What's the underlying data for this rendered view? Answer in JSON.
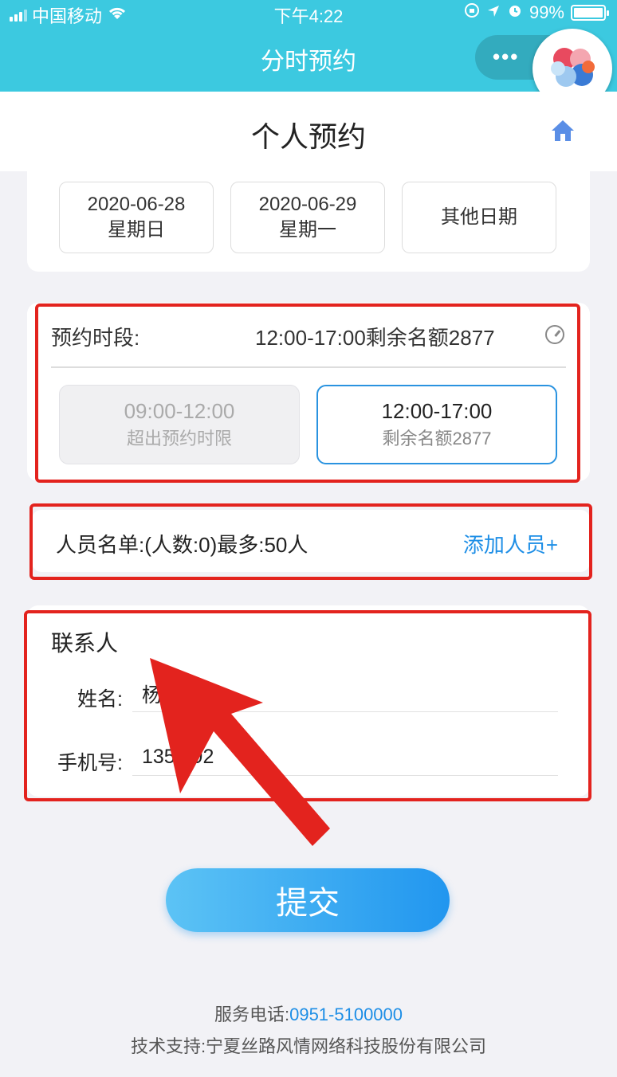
{
  "status_bar": {
    "carrier": "中国移动",
    "time": "下午4:22",
    "battery": "99%",
    "battery_level": 0.99
  },
  "nav": {
    "title": "分时预约",
    "more_icon": "more-dots-icon",
    "float_icon": "colorful-logo-icon"
  },
  "page": {
    "title": "个人预约",
    "home_icon": "home-icon"
  },
  "dates": [
    {
      "date": "2020-06-28",
      "weekday": "星期日"
    },
    {
      "date": "2020-06-29",
      "weekday": "星期一"
    },
    {
      "label": "其他日期"
    }
  ],
  "time_period": {
    "label": "预约时段:",
    "selected": "12:00-17:00剩余名额2877",
    "icon": "gauge-icon",
    "slots": [
      {
        "time": "09:00-12:00",
        "status": "超出预约时限",
        "disabled": true
      },
      {
        "time": "12:00-17:00",
        "status": "剩余名额2877",
        "disabled": false
      }
    ]
  },
  "people": {
    "text": "人员名单:(人数:0)最多:50人",
    "add_label": "添加人员+"
  },
  "contact": {
    "title": "联系人",
    "name_label": "姓名:",
    "name_value": "杨",
    "phone_label": "手机号:",
    "phone_value": "135   92     1"
  },
  "submit_label": "提交",
  "footer": {
    "phone_label": "服务电话:",
    "phone": "0951-5100000",
    "support": "技术支持:宁夏丝路风情网络科技股份有限公司"
  },
  "colors": {
    "nav_bg": "#3cc9e0",
    "accent": "#1d8ee6",
    "highlight": "#e3231e",
    "arrow": "#e3231e"
  }
}
